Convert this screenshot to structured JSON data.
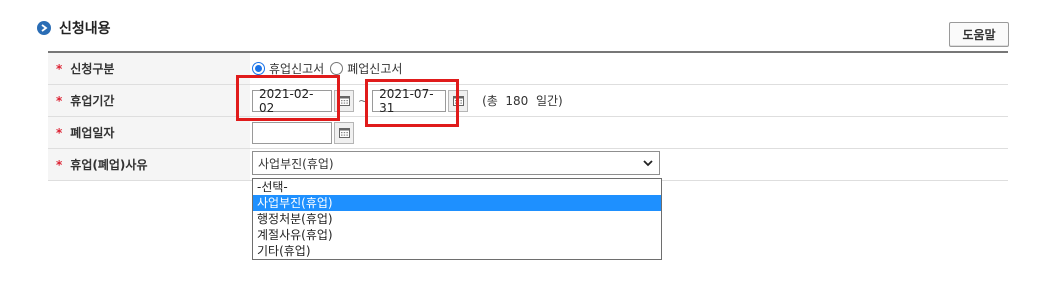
{
  "section": {
    "title": "신청내용"
  },
  "help_button": "도움말",
  "form": {
    "rows": [
      {
        "label": "신청구분",
        "required_mark": "*"
      },
      {
        "label": "휴업기간",
        "required_mark": "*"
      },
      {
        "label": "폐업일자",
        "required_mark": "*"
      },
      {
        "label": "휴업(폐업)사유",
        "required_mark": "*"
      }
    ],
    "report_type": {
      "options": [
        "휴업신고서",
        "폐업신고서"
      ],
      "selected": "휴업신고서"
    },
    "period": {
      "start": "2021-02-02",
      "separator": "~",
      "end": "2021-07-31",
      "total_text": "(총  180  일간)"
    },
    "closure_date": {
      "value": ""
    },
    "reason": {
      "selected": "사업부진(휴업)",
      "options": [
        "-선택-",
        "사업부진(휴업)",
        "행정처분(휴업)",
        "계절사유(휴업)",
        "기타(휴업)"
      ],
      "highlighted_index": 1
    }
  },
  "colors": {
    "highlight": "#1e90ff",
    "annotation": "#e01b1b",
    "required": "#dd2233"
  }
}
